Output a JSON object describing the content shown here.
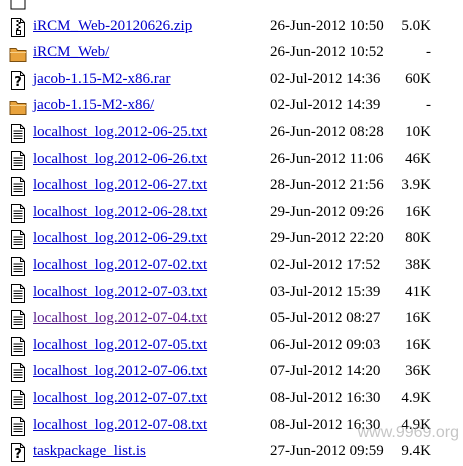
{
  "files": [
    {
      "name": "iRCM_Web-20120626.zip",
      "date": "26-Jun-2012 10:50",
      "size": "5.0K",
      "icon": "compressed-file-icon",
      "visited": false
    },
    {
      "name": "iRCM_Web/",
      "date": "26-Jun-2012 10:52",
      "size": "-",
      "icon": "folder-icon",
      "visited": false
    },
    {
      "name": "jacob-1.15-M2-x86.rar",
      "date": "02-Jul-2012 14:36",
      "size": "60K",
      "icon": "unknown-file-icon",
      "visited": false
    },
    {
      "name": "jacob-1.15-M2-x86/",
      "date": "02-Jul-2012 14:39",
      "size": "-",
      "icon": "folder-icon",
      "visited": false
    },
    {
      "name": "localhost_log.2012-06-25.txt",
      "date": "26-Jun-2012 08:28",
      "size": "10K",
      "icon": "text-file-icon",
      "visited": false
    },
    {
      "name": "localhost_log.2012-06-26.txt",
      "date": "26-Jun-2012 11:06",
      "size": "46K",
      "icon": "text-file-icon",
      "visited": false
    },
    {
      "name": "localhost_log.2012-06-27.txt",
      "date": "28-Jun-2012 21:56",
      "size": "3.9K",
      "icon": "text-file-icon",
      "visited": false
    },
    {
      "name": "localhost_log.2012-06-28.txt",
      "date": "29-Jun-2012 09:26",
      "size": "16K",
      "icon": "text-file-icon",
      "visited": false
    },
    {
      "name": "localhost_log.2012-06-29.txt",
      "date": "29-Jun-2012 22:20",
      "size": "80K",
      "icon": "text-file-icon",
      "visited": false
    },
    {
      "name": "localhost_log.2012-07-02.txt",
      "date": "02-Jul-2012 17:52",
      "size": "38K",
      "icon": "text-file-icon",
      "visited": false
    },
    {
      "name": "localhost_log.2012-07-03.txt",
      "date": "03-Jul-2012 15:39",
      "size": "41K",
      "icon": "text-file-icon",
      "visited": false
    },
    {
      "name": "localhost_log.2012-07-04.txt",
      "date": "05-Jul-2012 08:27",
      "size": "16K",
      "icon": "text-file-icon",
      "visited": true
    },
    {
      "name": "localhost_log.2012-07-05.txt",
      "date": "06-Jul-2012 09:03",
      "size": "16K",
      "icon": "text-file-icon",
      "visited": false
    },
    {
      "name": "localhost_log.2012-07-06.txt",
      "date": "07-Jul-2012 14:20",
      "size": "36K",
      "icon": "text-file-icon",
      "visited": false
    },
    {
      "name": "localhost_log.2012-07-07.txt",
      "date": "08-Jul-2012 16:30",
      "size": "4.9K",
      "icon": "text-file-icon",
      "visited": false
    },
    {
      "name": "localhost_log.2012-07-08.txt",
      "date": "08-Jul-2012 16:30",
      "size": "4.9K",
      "icon": "text-file-icon",
      "visited": false
    },
    {
      "name": "taskpackage_list.is",
      "date": "27-Jun-2012 09:59",
      "size": "9.4K",
      "icon": "unknown-file-icon",
      "visited": false
    }
  ],
  "colors": {
    "link": "#0000cc",
    "visited_link": "#551a8b",
    "folder": "#e8a23c"
  },
  "watermark": "www.9969.org"
}
